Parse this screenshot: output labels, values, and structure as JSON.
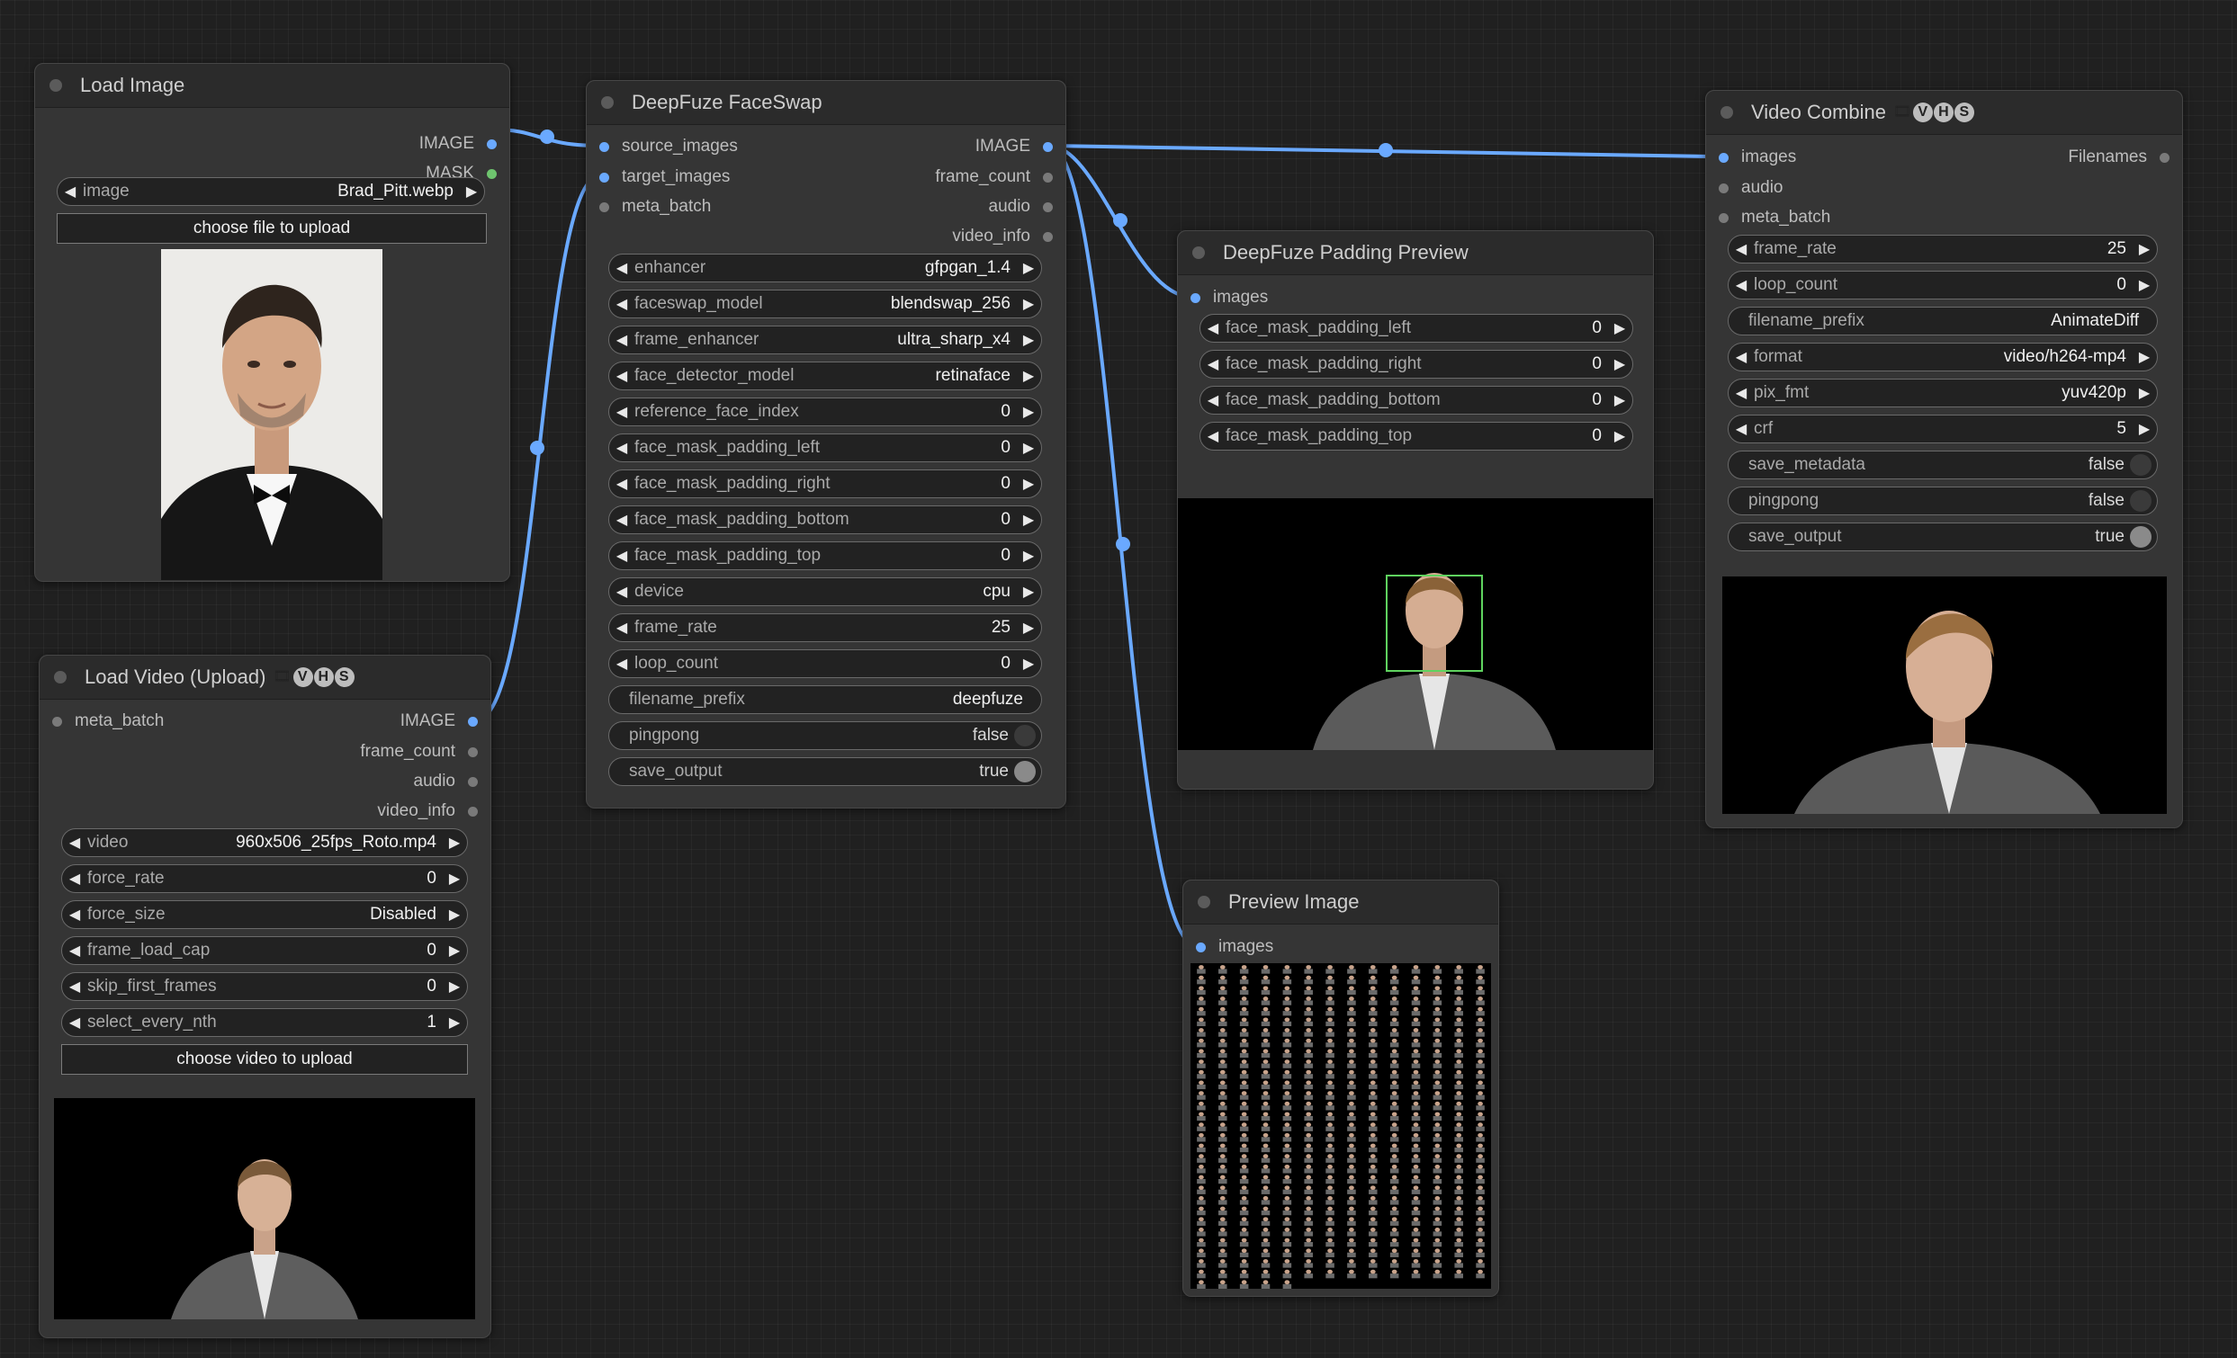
{
  "nodes": {
    "load_image": {
      "title": "Load Image",
      "outputs": [
        "IMAGE",
        "MASK"
      ],
      "widget": {
        "name": "image",
        "value": "Brad_Pitt.webp"
      },
      "upload_label": "choose file to upload",
      "preview_alt": "portrait photo"
    },
    "load_video": {
      "title": "Load Video (Upload)",
      "inputs": [
        "meta_batch"
      ],
      "outputs": [
        "IMAGE",
        "frame_count",
        "audio",
        "video_info"
      ],
      "widgets": [
        {
          "name": "video",
          "value": "960x506_25fps_Roto.mp4"
        },
        {
          "name": "force_rate",
          "value": "0"
        },
        {
          "name": "force_size",
          "value": "Disabled"
        },
        {
          "name": "frame_load_cap",
          "value": "0"
        },
        {
          "name": "skip_first_frames",
          "value": "0"
        },
        {
          "name": "select_every_nth",
          "value": "1"
        }
      ],
      "upload_label": "choose video to upload"
    },
    "faceswap": {
      "title": "DeepFuze FaceSwap",
      "inputs": [
        "source_images",
        "target_images",
        "meta_batch"
      ],
      "outputs": [
        "IMAGE",
        "frame_count",
        "audio",
        "video_info"
      ],
      "widgets": [
        {
          "name": "enhancer",
          "value": "gfpgan_1.4"
        },
        {
          "name": "faceswap_model",
          "value": "blendswap_256"
        },
        {
          "name": "frame_enhancer",
          "value": "ultra_sharp_x4"
        },
        {
          "name": "face_detector_model",
          "value": "retinaface"
        },
        {
          "name": "reference_face_index",
          "value": "0"
        },
        {
          "name": "face_mask_padding_left",
          "value": "0"
        },
        {
          "name": "face_mask_padding_right",
          "value": "0"
        },
        {
          "name": "face_mask_padding_bottom",
          "value": "0"
        },
        {
          "name": "face_mask_padding_top",
          "value": "0"
        },
        {
          "name": "device",
          "value": "cpu"
        },
        {
          "name": "frame_rate",
          "value": "25"
        },
        {
          "name": "loop_count",
          "value": "0"
        }
      ],
      "text_widget": {
        "name": "filename_prefix",
        "value": "deepfuze"
      },
      "toggles": [
        {
          "name": "pingpong",
          "value": "false"
        },
        {
          "name": "save_output",
          "value": "true"
        }
      ]
    },
    "padding_preview": {
      "title": "DeepFuze Padding Preview",
      "inputs": [
        "images"
      ],
      "widgets": [
        {
          "name": "face_mask_padding_left",
          "value": "0"
        },
        {
          "name": "face_mask_padding_right",
          "value": "0"
        },
        {
          "name": "face_mask_padding_bottom",
          "value": "0"
        },
        {
          "name": "face_mask_padding_top",
          "value": "0"
        }
      ]
    },
    "preview_image": {
      "title": "Preview Image",
      "inputs": [
        "images"
      ]
    },
    "video_combine": {
      "title": "Video Combine",
      "inputs": [
        "images",
        "audio",
        "meta_batch"
      ],
      "outputs": [
        "Filenames"
      ],
      "widgets_a": [
        {
          "name": "frame_rate",
          "value": "25"
        },
        {
          "name": "loop_count",
          "value": "0"
        }
      ],
      "text_widget": {
        "name": "filename_prefix",
        "value": "AnimateDiff"
      },
      "widgets_b": [
        {
          "name": "format",
          "value": "video/h264-mp4"
        },
        {
          "name": "pix_fmt",
          "value": "yuv420p"
        },
        {
          "name": "crf",
          "value": "5"
        }
      ],
      "toggles": [
        {
          "name": "save_metadata",
          "value": "false"
        },
        {
          "name": "pingpong",
          "value": "false"
        },
        {
          "name": "save_output",
          "value": "true"
        }
      ]
    }
  },
  "vhs_badge": "VHS",
  "colors": {
    "link": "#6aa9ff",
    "canvas": "#202020",
    "node": "#353535"
  }
}
